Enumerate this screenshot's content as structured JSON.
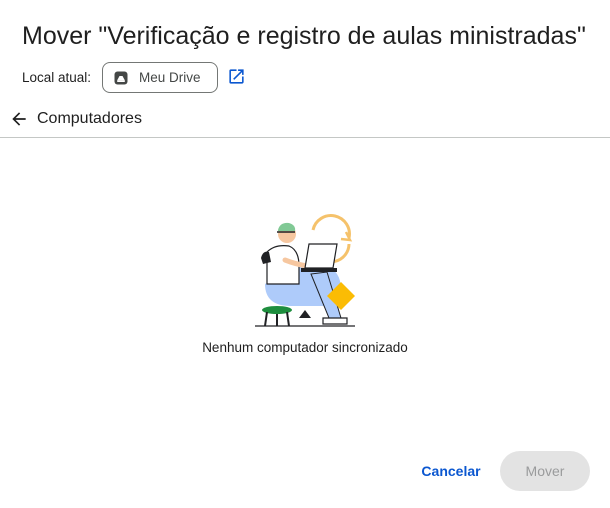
{
  "dialog": {
    "title": "Mover \"Verificação e registro de aulas ministradas\"",
    "location_label": "Local atual:",
    "location_chip": {
      "label": "Meu Drive",
      "icon": "drive-icon"
    },
    "open_location_icon": "open-in-new-icon"
  },
  "navigation": {
    "back_icon": "arrow-back-icon",
    "current_folder": "Computadores"
  },
  "empty_state": {
    "message": "Nenhum computador sincronizado",
    "illustration": "person-laptop-sync-illustration"
  },
  "footer": {
    "cancel_label": "Cancelar",
    "move_label": "Mover"
  },
  "colors": {
    "accent": "#0b57d0",
    "divider": "#c4c7c5",
    "disabled_bg": "#e3e3e3",
    "disabled_text": "#9a9b9c"
  }
}
